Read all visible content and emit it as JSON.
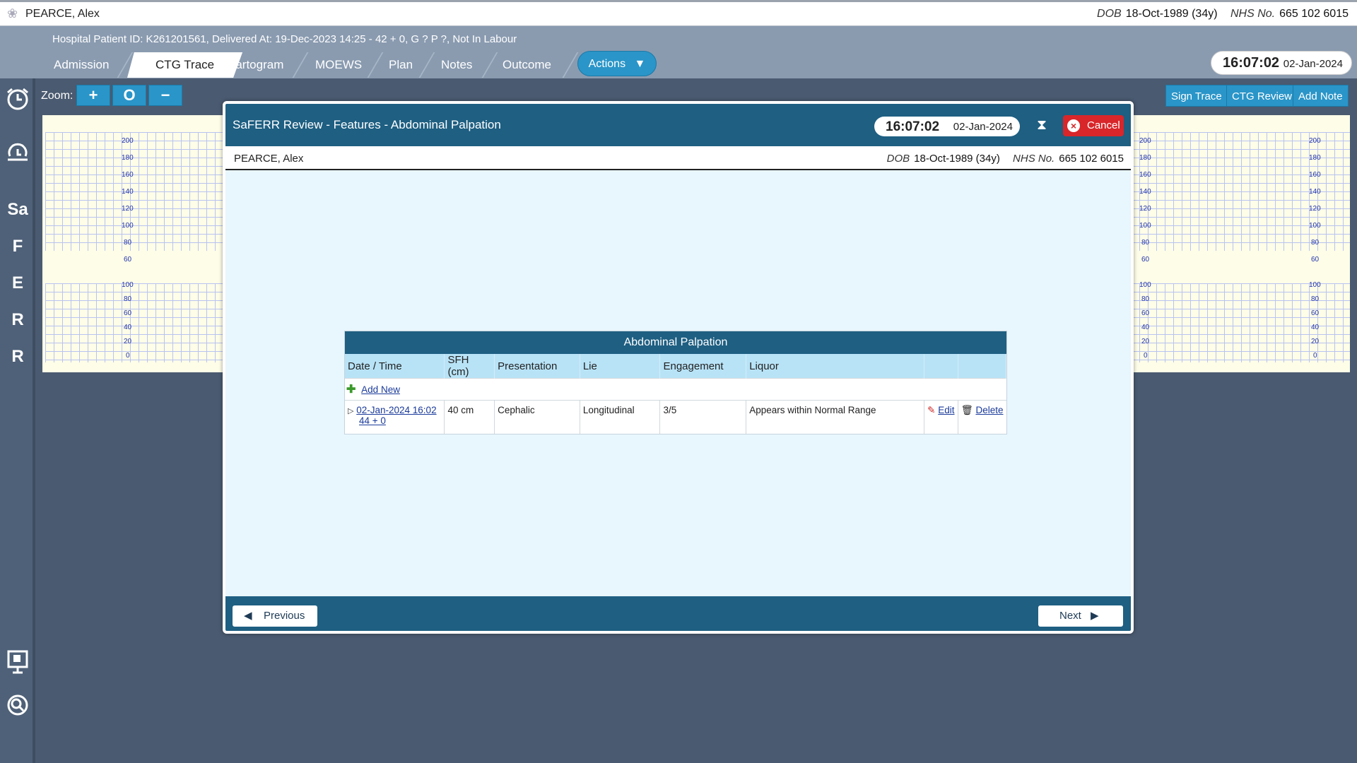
{
  "patient": {
    "name": "PEARCE, Alex",
    "dob_label": "DOB",
    "dob": "18-Oct-1989 (34y)",
    "nhs_label": "NHS No.",
    "nhs": "665 102 6015"
  },
  "header": {
    "info": "Hospital Patient ID: K261201561, Delivered At: 19-Dec-2023 14:25 - 42 + 0, G ? P ?,   Not In Labour",
    "tabs": [
      "Admission",
      "CTG Trace",
      "Partogram",
      "MOEWS",
      "Plan",
      "Notes",
      "Outcome"
    ],
    "active_tab": "CTG Trace",
    "actions_label": "Actions",
    "time": "16:07:02",
    "date": "02-Jan-2024"
  },
  "sidebar": {
    "letters": [
      "Sa",
      "F",
      "E",
      "R",
      "R"
    ],
    "icons": [
      "alarm-clock-icon",
      "history-icon",
      "presentation-icon",
      "search-icon"
    ]
  },
  "toolbar": {
    "zoom_label": "Zoom:",
    "zoom_in": "+",
    "zoom_reset": "O",
    "zoom_out": "−",
    "sign_trace": "Sign Trace",
    "ctg_review": "CTG Review",
    "add_note": "Add Note"
  },
  "ctg": {
    "fhr_ticks": [
      "200",
      "180",
      "160",
      "140",
      "120",
      "100",
      "80",
      "60"
    ],
    "toco_ticks": [
      "100",
      "80",
      "60",
      "40",
      "20",
      "0"
    ]
  },
  "modal": {
    "title": "SaFERR Review - Features - Abdominal Palpation",
    "time": "16:07:02",
    "date": "02-Jan-2024",
    "cancel_label": "Cancel",
    "previous_label": "Previous",
    "next_label": "Next",
    "table": {
      "caption": "Abdominal Palpation",
      "columns": [
        "Date / Time",
        "SFH (cm)",
        "Presentation",
        "Lie",
        "Engagement",
        "Liquor"
      ],
      "add_new": "Add New",
      "row": {
        "datetime": "02-Jan-2024 16:02",
        "gestation": "44 + 0",
        "sfh": "40 cm",
        "presentation": "Cephalic",
        "lie": "Longitudinal",
        "engagement": "3/5",
        "liquor": "Appears within Normal Range",
        "edit": "Edit",
        "delete": "Delete"
      }
    }
  }
}
